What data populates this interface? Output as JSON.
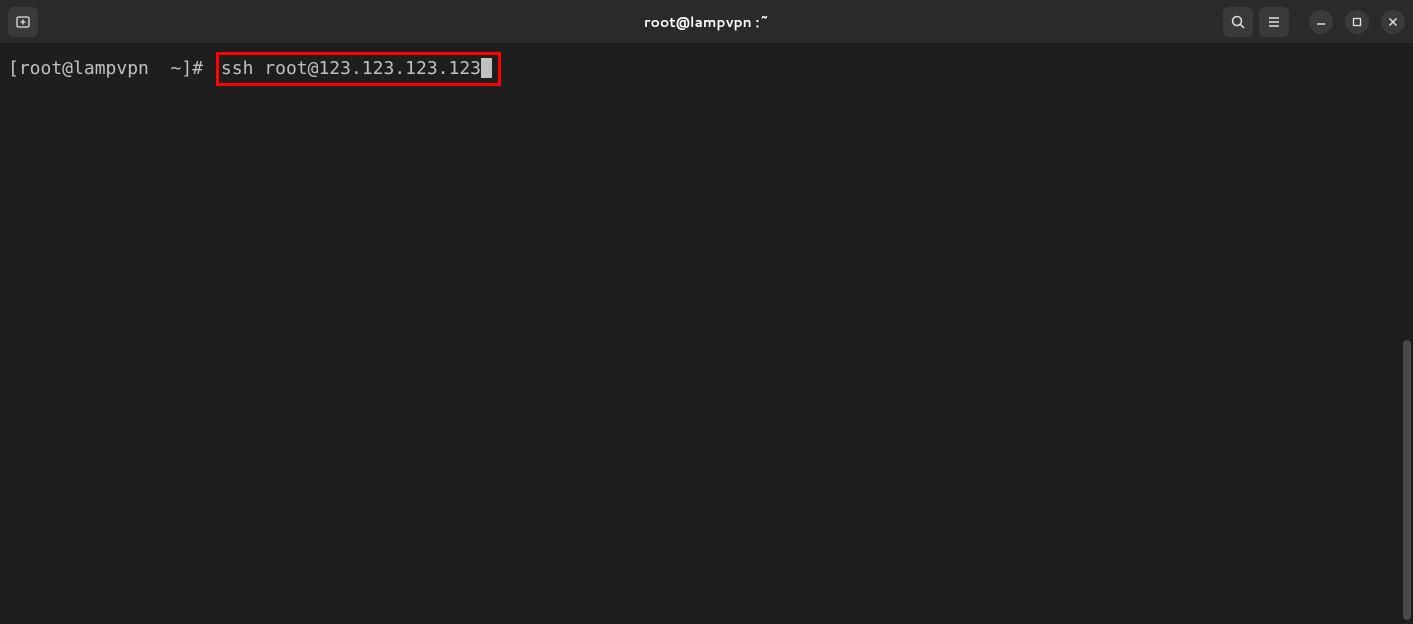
{
  "titlebar": {
    "title": "root@lampvpn :~"
  },
  "terminal": {
    "prompt": "[root@lampvpn  ~]#",
    "command": "ssh root@123.123.123.123"
  }
}
